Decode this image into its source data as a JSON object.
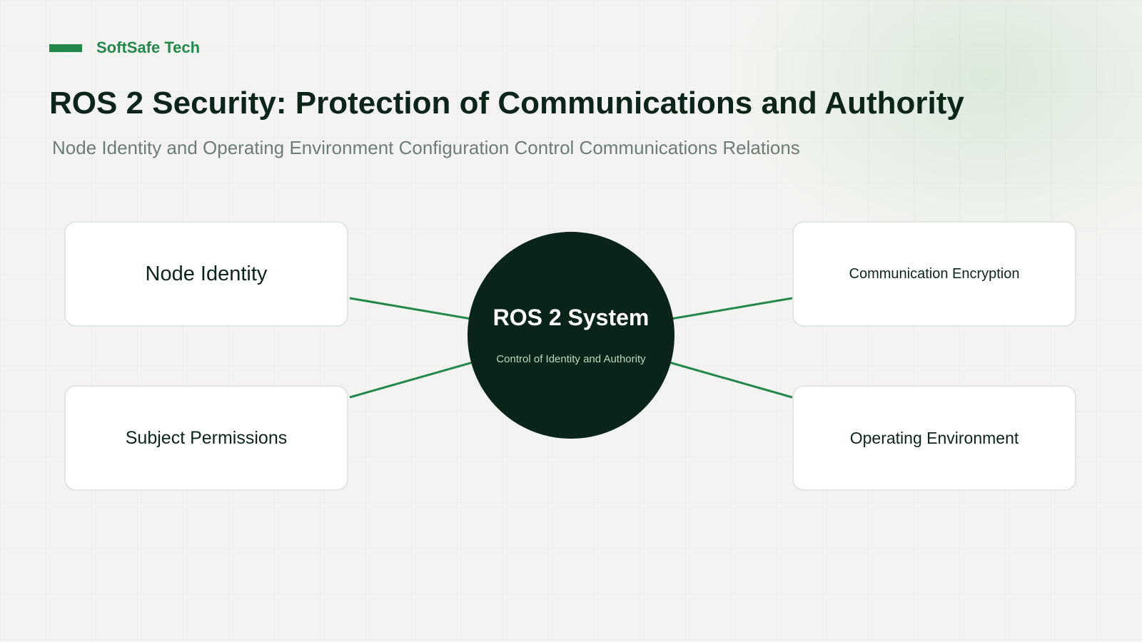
{
  "brand": {
    "name": "SoftSafe Tech",
    "accent_color": "#23884a"
  },
  "header": {
    "title": "ROS 2 Security: Protection of Communications and Authority",
    "subtitle": "Node Identity and Operating Environment Configuration Control Communications Relations"
  },
  "diagram": {
    "center": {
      "title": "ROS 2 System",
      "subtitle": "Control of Identity and Authority",
      "color": "#0b2419"
    },
    "nodes": [
      {
        "label": "Node Identity"
      },
      {
        "label": "Subject Permissions"
      },
      {
        "label": "Communication Encryption"
      },
      {
        "label": "Operating Environment"
      }
    ],
    "connector_color": "#23884a"
  }
}
